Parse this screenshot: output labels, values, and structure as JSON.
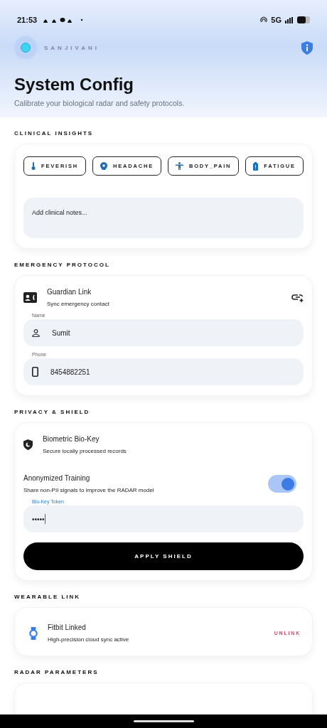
{
  "status_bar": {
    "time": "21:53",
    "network": "5G"
  },
  "header": {
    "app_name": "SANJIVANI"
  },
  "page": {
    "title": "System Config",
    "subtitle": "Calibrate your biological radar and safety protocols."
  },
  "clinical": {
    "heading": "CLINICAL INSIGHTS",
    "symptoms": [
      {
        "label": "FEVERISH",
        "kind": "thermometer"
      },
      {
        "label": "HEADACHE",
        "kind": "head"
      },
      {
        "label": "BODY_PAIN",
        "kind": "body"
      },
      {
        "label": "FATIGUE",
        "kind": "battery"
      }
    ],
    "notes": {
      "placeholder": "Add clinical notes..."
    }
  },
  "emergency": {
    "heading": "EMERGENCY PROTOCOL",
    "title": "Guardian Link",
    "subtitle": "Sync emergency contact",
    "fields": [
      {
        "label": "Name",
        "value": "Sumit",
        "kind": "person"
      },
      {
        "label": "Phone",
        "value": "8454882251",
        "kind": "phone"
      }
    ]
  },
  "privacy": {
    "heading": "PRIVACY & SHIELD",
    "biometric": {
      "title": "Biometric Bio-Key",
      "subtitle": "Secure locally processed records"
    },
    "training": {
      "title": "Anonymized Training",
      "subtitle": "Share non-PII signals to improve the RADAR model",
      "on": true
    },
    "token": {
      "label": "Bio-Key Token",
      "value": "•••••"
    },
    "button": "APPLY SHIELD"
  },
  "wearable": {
    "heading": "WEARABLE LINK",
    "title": "Fitbit Linked",
    "subtitle": "High-precision cloud sync active",
    "action": "UNLINK"
  },
  "radar": {
    "heading": "RADAR PARAMETERS"
  }
}
